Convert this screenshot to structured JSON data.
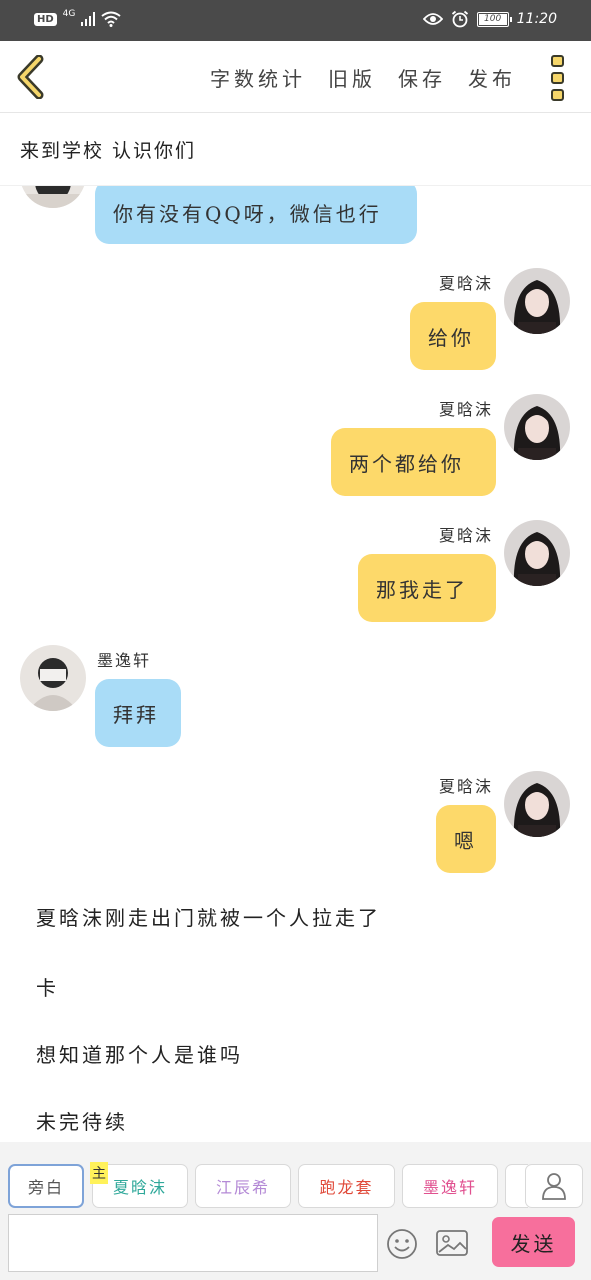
{
  "status_bar": {
    "hd": "HD",
    "network": "4G",
    "battery": "100",
    "battery_level": 1.0,
    "time": "11:20"
  },
  "toolbar": {
    "word_count": "字数统计",
    "old_version": "旧版",
    "save": "保存",
    "publish": "发布"
  },
  "title": "来到学校  认识你们",
  "messages": [
    {
      "side": "left",
      "sender": "",
      "text": "你有没有QQ呀，微信也行",
      "color": "#a9dcf7"
    },
    {
      "side": "right",
      "sender": "夏晗沫",
      "text": "给你",
      "color": "#fdd96a"
    },
    {
      "side": "right",
      "sender": "夏晗沫",
      "text": "两个都给你",
      "color": "#fdd96a"
    },
    {
      "side": "right",
      "sender": "夏晗沫",
      "text": "那我走了",
      "color": "#fdd96a"
    },
    {
      "side": "left",
      "sender": "墨逸轩",
      "text": "拜拜",
      "color": "#a9dcf7"
    },
    {
      "side": "right",
      "sender": "夏晗沫",
      "text": "嗯",
      "color": "#fdd96a"
    }
  ],
  "narration": [
    "夏晗沫刚走出门就被一个人拉走了",
    "卡",
    "想知道那个人是谁吗",
    "未完待续"
  ],
  "characters": [
    {
      "name": "旁白",
      "color": "#555555"
    },
    {
      "name": "夏晗沫",
      "color": "#2fa89a"
    },
    {
      "name": "江辰希",
      "color": "#b48ad6"
    },
    {
      "name": "跑龙套",
      "color": "#e04a3a"
    },
    {
      "name": "墨逸轩",
      "color": "#e0508f"
    }
  ],
  "protagonist_badge": "主",
  "input": {
    "value": "",
    "placeholder": ""
  },
  "send_label": "发送"
}
